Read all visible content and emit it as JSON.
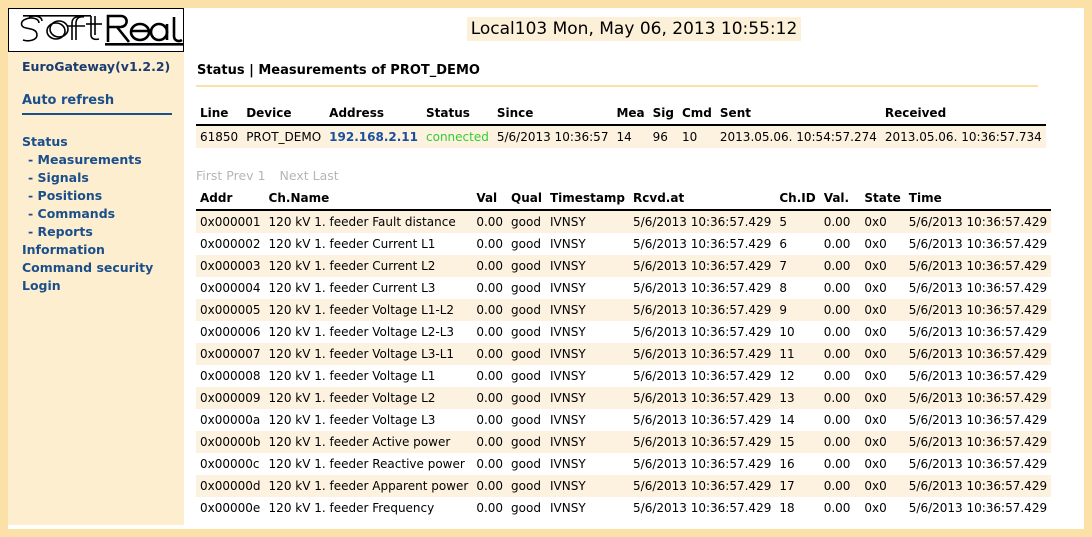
{
  "brand": {
    "logo_text": "SoftReal",
    "product": "EuroGateway(v1.2.2)"
  },
  "sidebar": {
    "auto_refresh": "Auto refresh",
    "items": [
      {
        "label": "Status",
        "sub": false
      },
      {
        "label": "Measurements",
        "sub": true
      },
      {
        "label": "Signals",
        "sub": true
      },
      {
        "label": "Positions",
        "sub": true
      },
      {
        "label": "Commands",
        "sub": true
      },
      {
        "label": "Reports",
        "sub": true
      },
      {
        "label": "Information",
        "sub": false
      },
      {
        "label": "Command security",
        "sub": false
      },
      {
        "label": "Login",
        "sub": false
      }
    ]
  },
  "header": {
    "clock": "Local103 Mon, May 06, 2013 10:55:12",
    "page_title": "Status | Measurements of PROT_DEMO"
  },
  "status_table": {
    "columns": [
      "Line",
      "Device",
      "Address",
      "Status",
      "Since",
      "Mea",
      "Sig",
      "Cmd",
      "Sent",
      "Received"
    ],
    "rows": [
      {
        "line": "61850",
        "device": "PROT_DEMO",
        "address": "192.168.2.11",
        "status": "connected",
        "since": "5/6/2013 10:36:57",
        "mea": "14",
        "sig": "96",
        "cmd": "10",
        "sent": "2013.05.06. 10:54:57.274",
        "received": "2013.05.06. 10:36:57.734"
      }
    ]
  },
  "pager": {
    "first": "First",
    "prev": "Prev",
    "page": "1",
    "next": "Next",
    "last": "Last"
  },
  "meas_table": {
    "columns": [
      "Addr",
      "Ch.Name",
      "Val",
      "Qual",
      "Timestamp",
      "Rcvd.at",
      "Ch.ID",
      "Val.",
      "State",
      "Time"
    ],
    "rows": [
      {
        "addr": "0x000001",
        "name": "120 kV 1. feeder Fault distance",
        "val": "0.00",
        "qual": "good",
        "timestamp": "IVNSY",
        "rcvd": "5/6/2013 10:36:57.429",
        "chid": "5",
        "val2": "0.00",
        "state": "0x0",
        "time": "5/6/2013 10:36:57.429"
      },
      {
        "addr": "0x000002",
        "name": "120 kV 1. feeder Current L1",
        "val": "0.00",
        "qual": "good",
        "timestamp": "IVNSY",
        "rcvd": "5/6/2013 10:36:57.429",
        "chid": "6",
        "val2": "0.00",
        "state": "0x0",
        "time": "5/6/2013 10:36:57.429"
      },
      {
        "addr": "0x000003",
        "name": "120 kV 1. feeder Current L2",
        "val": "0.00",
        "qual": "good",
        "timestamp": "IVNSY",
        "rcvd": "5/6/2013 10:36:57.429",
        "chid": "7",
        "val2": "0.00",
        "state": "0x0",
        "time": "5/6/2013 10:36:57.429"
      },
      {
        "addr": "0x000004",
        "name": "120 kV 1. feeder Current L3",
        "val": "0.00",
        "qual": "good",
        "timestamp": "IVNSY",
        "rcvd": "5/6/2013 10:36:57.429",
        "chid": "8",
        "val2": "0.00",
        "state": "0x0",
        "time": "5/6/2013 10:36:57.429"
      },
      {
        "addr": "0x000005",
        "name": "120 kV 1. feeder Voltage L1-L2",
        "val": "0.00",
        "qual": "good",
        "timestamp": "IVNSY",
        "rcvd": "5/6/2013 10:36:57.429",
        "chid": "9",
        "val2": "0.00",
        "state": "0x0",
        "time": "5/6/2013 10:36:57.429"
      },
      {
        "addr": "0x000006",
        "name": "120 kV 1. feeder Voltage L2-L3",
        "val": "0.00",
        "qual": "good",
        "timestamp": "IVNSY",
        "rcvd": "5/6/2013 10:36:57.429",
        "chid": "10",
        "val2": "0.00",
        "state": "0x0",
        "time": "5/6/2013 10:36:57.429"
      },
      {
        "addr": "0x000007",
        "name": "120 kV 1. feeder Voltage L3-L1",
        "val": "0.00",
        "qual": "good",
        "timestamp": "IVNSY",
        "rcvd": "5/6/2013 10:36:57.429",
        "chid": "11",
        "val2": "0.00",
        "state": "0x0",
        "time": "5/6/2013 10:36:57.429"
      },
      {
        "addr": "0x000008",
        "name": "120 kV 1. feeder Voltage L1",
        "val": "0.00",
        "qual": "good",
        "timestamp": "IVNSY",
        "rcvd": "5/6/2013 10:36:57.429",
        "chid": "12",
        "val2": "0.00",
        "state": "0x0",
        "time": "5/6/2013 10:36:57.429"
      },
      {
        "addr": "0x000009",
        "name": "120 kV 1. feeder Voltage L2",
        "val": "0.00",
        "qual": "good",
        "timestamp": "IVNSY",
        "rcvd": "5/6/2013 10:36:57.429",
        "chid": "13",
        "val2": "0.00",
        "state": "0x0",
        "time": "5/6/2013 10:36:57.429"
      },
      {
        "addr": "0x00000a",
        "name": "120 kV 1. feeder Voltage L3",
        "val": "0.00",
        "qual": "good",
        "timestamp": "IVNSY",
        "rcvd": "5/6/2013 10:36:57.429",
        "chid": "14",
        "val2": "0.00",
        "state": "0x0",
        "time": "5/6/2013 10:36:57.429"
      },
      {
        "addr": "0x00000b",
        "name": "120 kV 1. feeder Active power",
        "val": "0.00",
        "qual": "good",
        "timestamp": "IVNSY",
        "rcvd": "5/6/2013 10:36:57.429",
        "chid": "15",
        "val2": "0.00",
        "state": "0x0",
        "time": "5/6/2013 10:36:57.429"
      },
      {
        "addr": "0x00000c",
        "name": "120 kV 1. feeder Reactive power",
        "val": "0.00",
        "qual": "good",
        "timestamp": "IVNSY",
        "rcvd": "5/6/2013 10:36:57.429",
        "chid": "16",
        "val2": "0.00",
        "state": "0x0",
        "time": "5/6/2013 10:36:57.429"
      },
      {
        "addr": "0x00000d",
        "name": "120 kV 1. feeder Apparent power",
        "val": "0.00",
        "qual": "good",
        "timestamp": "IVNSY",
        "rcvd": "5/6/2013 10:36:57.429",
        "chid": "17",
        "val2": "0.00",
        "state": "0x0",
        "time": "5/6/2013 10:36:57.429"
      },
      {
        "addr": "0x00000e",
        "name": "120 kV 1. feeder Frequency",
        "val": "0.00",
        "qual": "good",
        "timestamp": "IVNSY",
        "rcvd": "5/6/2013 10:36:57.429",
        "chid": "18",
        "val2": "0.00",
        "state": "0x0",
        "time": "5/6/2013 10:36:57.429"
      }
    ]
  },
  "colors": {
    "frame": "#fbe1a8",
    "sidebar_bg": "#fdeed0",
    "nav_link": "#1a4f8a",
    "row_alt": "#fdf2e0",
    "link": "#1a4f9c",
    "connected": "#33cc33",
    "pager_disabled": "#b6b6b6"
  }
}
